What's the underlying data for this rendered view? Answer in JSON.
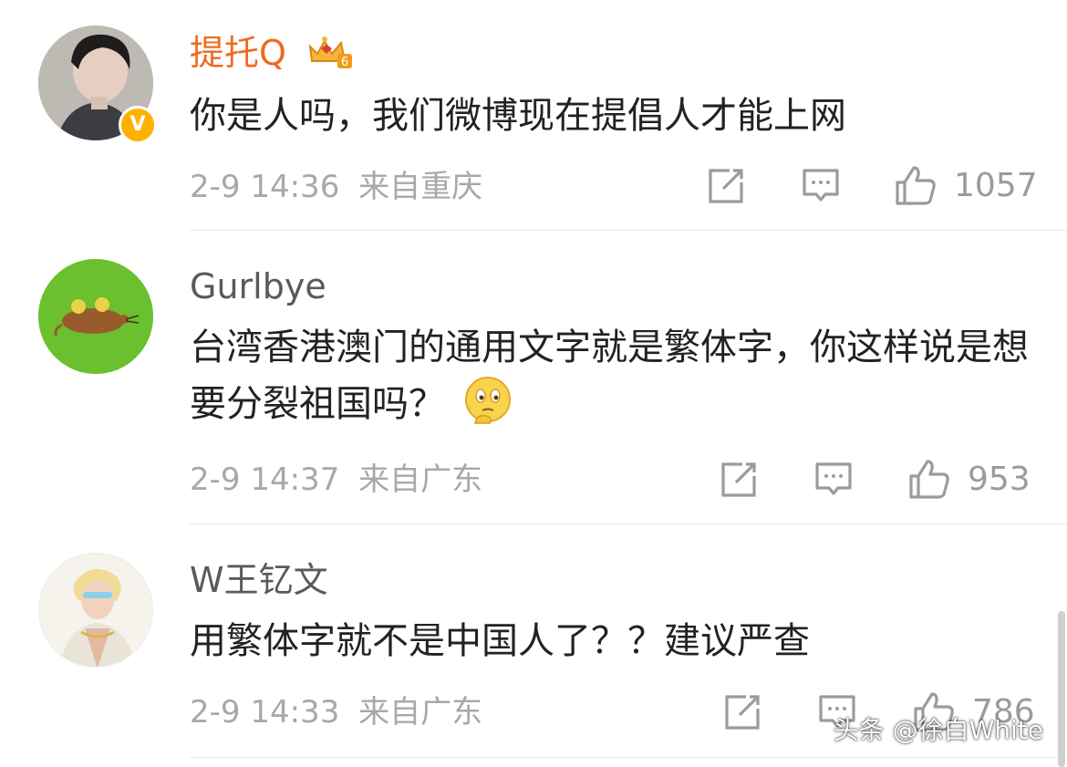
{
  "comments": [
    {
      "username": "提托Q",
      "username_color": "#ef6a20",
      "badge": "crown-level-badge",
      "badge_level": "6",
      "verified": true,
      "text": "你是人吗，我们微博现在提倡人才能上网",
      "time": "2-9 14:36",
      "location": "来自重庆",
      "likes": "1057"
    },
    {
      "username": "Gurlbye",
      "username_color": "#5a5a5a",
      "text": "台湾香港澳门的通用文字就是繁体字，你这样说是想要分裂祖国吗？",
      "emoji": "thinking-face-emoji",
      "time": "2-9 14:37",
      "location": "来自广东",
      "likes": "953"
    },
    {
      "username": "W王钇文",
      "username_color": "#5a5a5a",
      "text": "用繁体字就不是中国人了？？建议严查",
      "time": "2-9 14:33",
      "location": "来自广东",
      "likes": "786"
    }
  ],
  "icons": {
    "repost": "repost-icon",
    "comment": "comment-icon",
    "like": "thumbs-up-icon"
  },
  "watermark": "头条 @徐白White"
}
